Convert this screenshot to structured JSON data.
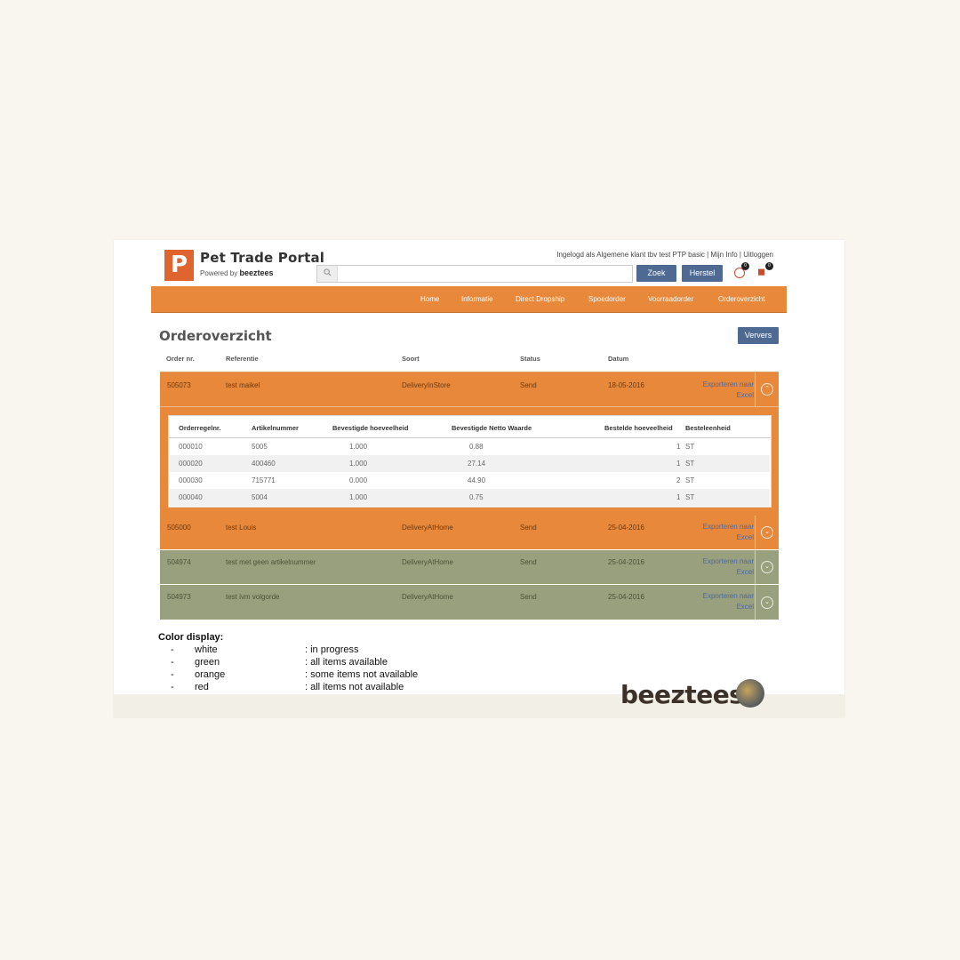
{
  "header": {
    "brand_title": "Pet Trade Portal",
    "powered_by": "Powered by",
    "powered_brand": "beeztees",
    "logo_letter": "P",
    "user_text": "Ingelogd als Algemene klant tbv  test PTP basic",
    "my_info": "Mijn Info",
    "logout": "Uitloggen",
    "separator": "|",
    "search_placeholder": "",
    "search_button": "Zoek",
    "reset_button": "Herstel",
    "clock_badge": "0",
    "cart_badge": "0"
  },
  "nav": {
    "items": [
      "Home",
      "Informatie",
      "Direct Dropship",
      "Spoedorder",
      "Voorraadorder",
      "Orderoverzicht"
    ]
  },
  "main": {
    "title": "Orderoverzicht",
    "refresh_button": "Ververs",
    "columns": [
      "Order nr.",
      "Referentie",
      "Soort",
      "Status",
      "Datum"
    ],
    "export_line1": "Exporteren naar",
    "export_line2": "Excel",
    "orders": [
      {
        "nr": "505073",
        "ref": "test maikel",
        "soort": "DeliveryInStore",
        "status": "Send",
        "datum": "18-05-2016",
        "color": "orange",
        "expanded": true
      },
      {
        "nr": "505000",
        "ref": "test Louis",
        "soort": "DeliveryAtHome",
        "status": "Send",
        "datum": "25-04-2016",
        "color": "orange",
        "expanded": false
      },
      {
        "nr": "504974",
        "ref": "test met geen artikelnummer",
        "soort": "DeliveryAtHome",
        "status": "Send",
        "datum": "25-04-2016",
        "color": "green",
        "expanded": false
      },
      {
        "nr": "504973",
        "ref": "test ivm volgorde",
        "soort": "DeliveryAtHome",
        "status": "Send",
        "datum": "25-04-2016",
        "color": "green",
        "expanded": false
      }
    ],
    "detail": {
      "columns": [
        "Orderregelnr.",
        "Artikelnummer",
        "Bevestigde hoeveelheid",
        "Bevestigde Netto Waarde",
        "Bestelde hoeveelheid",
        "Besteleenheid"
      ],
      "rows": [
        [
          "000010",
          "5005",
          "1.000",
          "0.88",
          "1",
          "ST"
        ],
        [
          "000020",
          "400460",
          "1.000",
          "27.14",
          "1",
          "ST"
        ],
        [
          "000030",
          "715771",
          "0.000",
          "44.90",
          "2",
          "ST"
        ],
        [
          "000040",
          "5004",
          "1.000",
          "0.75",
          "1",
          "ST"
        ]
      ]
    }
  },
  "legend": {
    "title": "Color display:",
    "items": [
      {
        "dash": "-",
        "color": "white",
        "desc": ": in progress"
      },
      {
        "dash": "-",
        "color": "green",
        "desc": ": all items available"
      },
      {
        "dash": "-",
        "color": "orange",
        "desc": ": some items not available"
      },
      {
        "dash": "-",
        "color": "red",
        "desc": ": all items not available"
      }
    ]
  },
  "footer": {
    "brand": "beeztees"
  },
  "colors": {
    "accent_orange": "#e7883a",
    "row_green": "#98a07d",
    "button_blue": "#4e6a92",
    "logo_orange": "#e0642e"
  },
  "icons": [
    "search-icon",
    "clock-icon",
    "cart-icon",
    "chevron-up-icon",
    "chevron-down-icon",
    "globe-icon"
  ]
}
